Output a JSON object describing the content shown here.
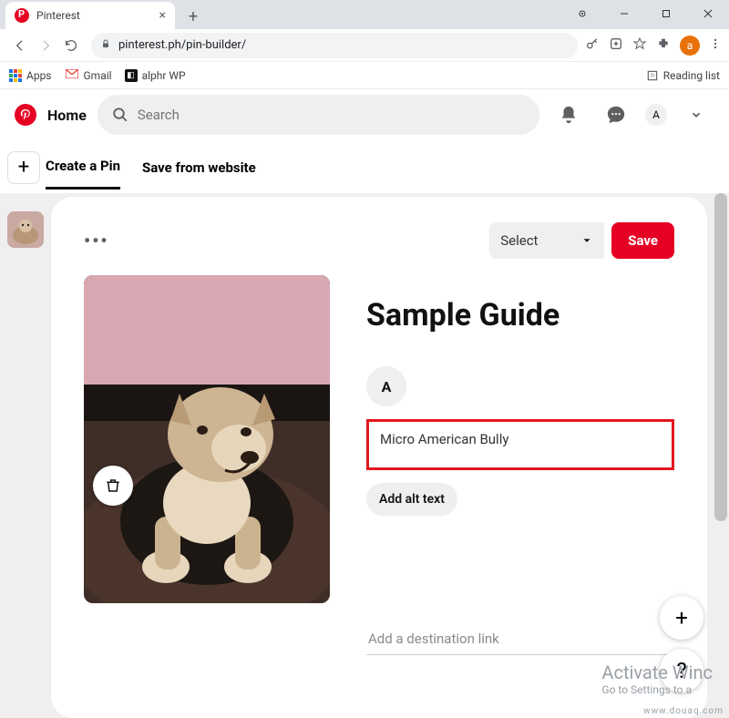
{
  "browser": {
    "tab_title": "Pinterest",
    "url": "pinterest.ph/pin-builder/",
    "bookmarks": {
      "apps": "Apps",
      "gmail": "Gmail",
      "alphr": "alphr WP",
      "reading_list": "Reading list"
    },
    "avatar_letter": "a"
  },
  "header": {
    "home": "Home",
    "search_placeholder": "Search",
    "user_letter": "A"
  },
  "builder_tabs": {
    "create": "Create a Pin",
    "save_site": "Save from website"
  },
  "editor": {
    "board_select": "Select",
    "save_btn": "Save",
    "title": "Sample Guide",
    "user_badge": "A",
    "description": "Micro American Bully",
    "alt_text_btn": "Add alt text",
    "destination_placeholder": "Add a destination link"
  },
  "overlay": {
    "activate": "Activate Winc",
    "settings_hint": "Go to Settings to a",
    "site": "www.douaq.com"
  }
}
